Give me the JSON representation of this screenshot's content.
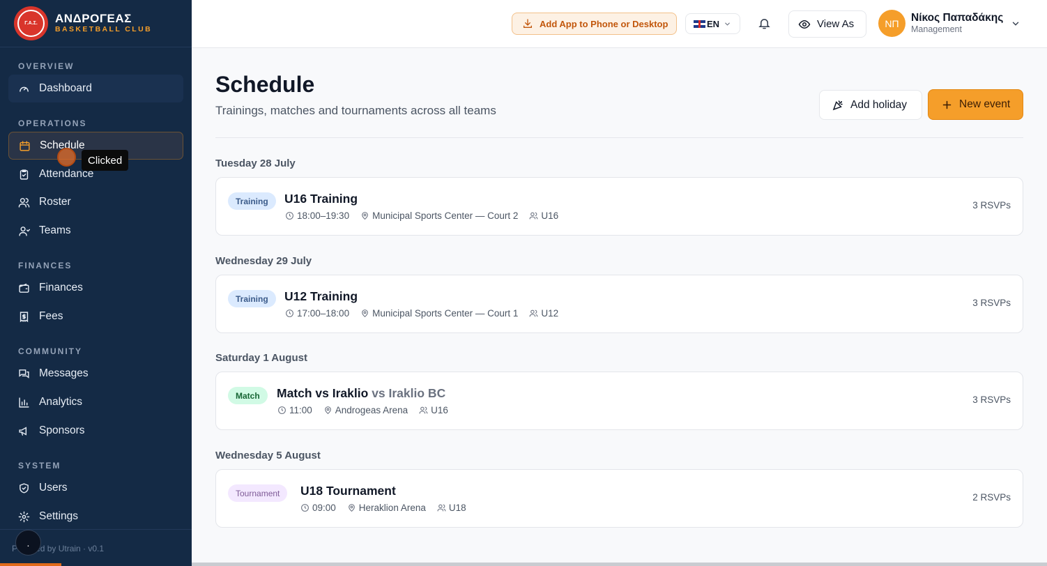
{
  "brand": {
    "name": "ΑΝΔΡΟΓΕΑΣ",
    "subtitle": "BASKETBALL CLUB",
    "logo_text": "Γ.Α.Σ."
  },
  "sidebar": {
    "sections": [
      {
        "title": "OVERVIEW"
      },
      {
        "title": "OPERATIONS"
      },
      {
        "title": "FINANCES"
      },
      {
        "title": "COMMUNITY"
      },
      {
        "title": "SYSTEM"
      }
    ],
    "items": [
      {
        "label": "Dashboard",
        "icon": "gauge-icon"
      },
      {
        "label": "Schedule",
        "icon": "calendar-icon",
        "active": true
      },
      {
        "label": "Attendance",
        "icon": "clipboard-check-icon"
      },
      {
        "label": "Roster",
        "icon": "users-icon"
      },
      {
        "label": "Teams",
        "icon": "user-group-icon"
      },
      {
        "label": "Finances",
        "icon": "wallet-icon"
      },
      {
        "label": "Fees",
        "icon": "receipt-icon"
      },
      {
        "label": "Messages",
        "icon": "chat-icon"
      },
      {
        "label": "Analytics",
        "icon": "bar-chart-icon"
      },
      {
        "label": "Sponsors",
        "icon": "megaphone-icon"
      },
      {
        "label": "Users",
        "icon": "shield-icon"
      },
      {
        "label": "Settings",
        "icon": "gear-icon"
      }
    ],
    "footer_text": "Powered by Utrain · v0.1",
    "footer_dot": "."
  },
  "overlay": {
    "tooltip": "Clicked"
  },
  "topbar": {
    "install_label": "Add App to Phone or Desktop",
    "language": "EN",
    "view_as_label": "View As",
    "user": {
      "initials": "ΝΠ",
      "name": "Νίκος Παπαδάκης",
      "role": "Management"
    }
  },
  "page": {
    "title": "Schedule",
    "subtitle": "Trainings, matches and tournaments across all teams",
    "add_holiday_label": "Add holiday",
    "new_event_label": "New event"
  },
  "days": [
    {
      "heading": "Tuesday 28 July",
      "event": {
        "type": "Training",
        "title": "U16 Training",
        "opponent": "",
        "time": "18:00–19:30",
        "location": "Municipal Sports Center — Court 2",
        "team": "U16",
        "rsvps": "3 RSVPs"
      }
    },
    {
      "heading": "Wednesday 29 July",
      "event": {
        "type": "Training",
        "title": "U12 Training",
        "opponent": "",
        "time": "17:00–18:00",
        "location": "Municipal Sports Center — Court 1",
        "team": "U12",
        "rsvps": "3 RSVPs"
      }
    },
    {
      "heading": "Saturday 1 August",
      "event": {
        "type": "Match",
        "title": "Match vs Iraklio",
        "opponent": "vs Iraklio BC",
        "time": "11:00",
        "location": "Androgeas Arena",
        "team": "U16",
        "rsvps": "3 RSVPs"
      }
    },
    {
      "heading": "Wednesday 5 August",
      "event": {
        "type": "Tournament",
        "title": "U18 Tournament",
        "opponent": "",
        "time": "09:00",
        "location": "Heraklion Arena",
        "team": "U18",
        "rsvps": "2 RSVPs"
      }
    }
  ],
  "colors": {
    "sidebar_bg": "#142a45",
    "accent": "#f59e2a",
    "brand_red": "#d9352b"
  }
}
